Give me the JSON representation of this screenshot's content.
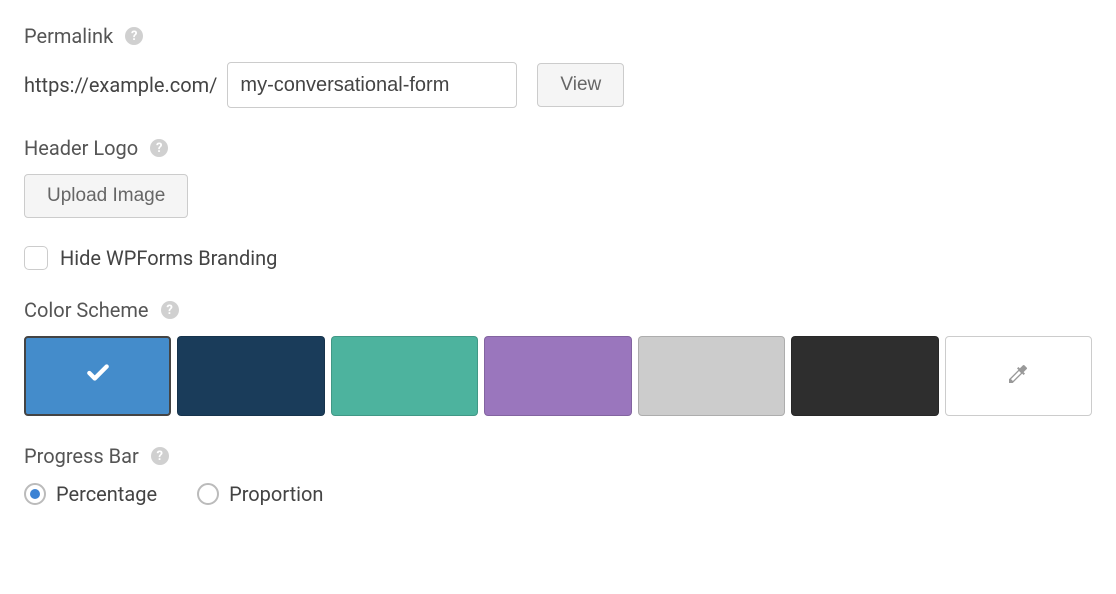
{
  "permalink": {
    "label": "Permalink",
    "prefix": "https://example.com/",
    "value": "my-conversational-form",
    "view_label": "View"
  },
  "header_logo": {
    "label": "Header Logo",
    "upload_label": "Upload Image"
  },
  "branding": {
    "label": "Hide WPForms Branding",
    "checked": false
  },
  "color_scheme": {
    "label": "Color Scheme",
    "swatches": [
      {
        "color": "#448ccb",
        "selected": true
      },
      {
        "color": "#1a3c5a",
        "selected": false
      },
      {
        "color": "#4db39e",
        "selected": false
      },
      {
        "color": "#9a76bd",
        "selected": false
      },
      {
        "color": "#cccccc",
        "selected": false
      },
      {
        "color": "#2e2e2e",
        "selected": false
      }
    ]
  },
  "progress_bar": {
    "label": "Progress Bar",
    "options": [
      {
        "label": "Percentage",
        "checked": true
      },
      {
        "label": "Proportion",
        "checked": false
      }
    ]
  }
}
